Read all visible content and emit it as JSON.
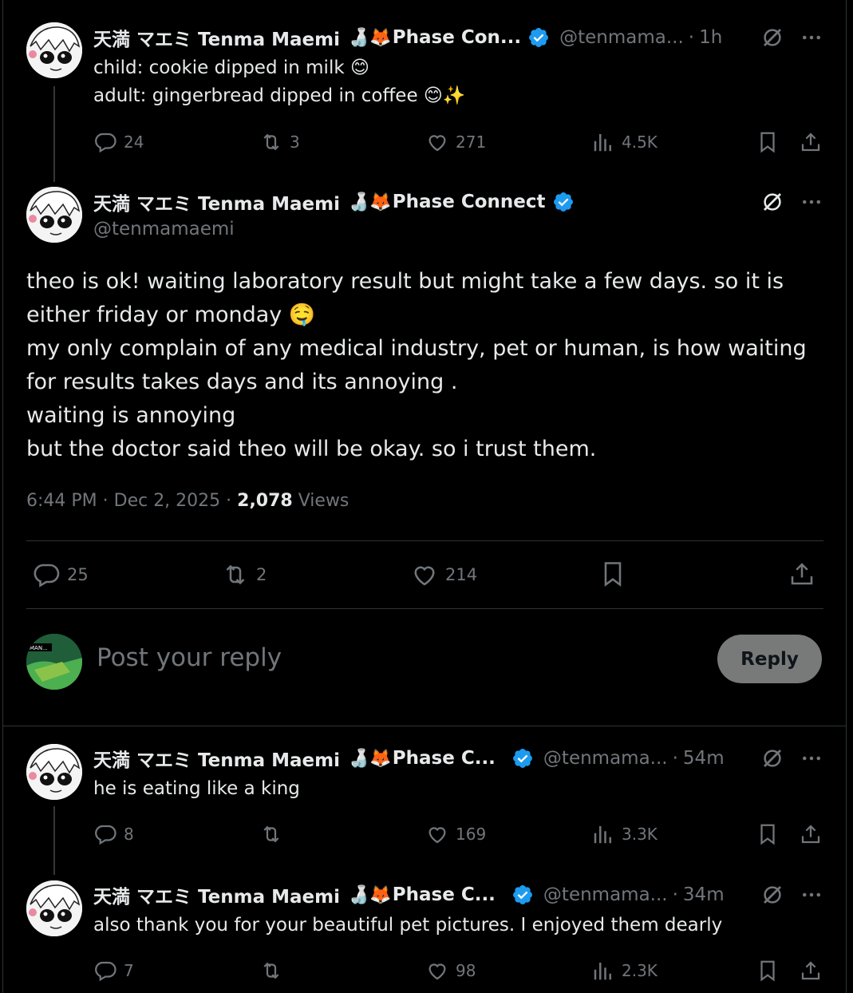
{
  "colors": {
    "background": "#000000",
    "text": "#e7e9ea",
    "muted": "#71767b",
    "verified": "#1d9bf0",
    "divider": "#2f3336",
    "reply_button": "#787a7a"
  },
  "author": {
    "display_name": "天満 マエミ Tenma Maemi",
    "emoji": "🍶🦊",
    "affiliation_short_1": "Phase Con...",
    "affiliation_short_2": "Phase C...",
    "affiliation_full": "Phase Connect",
    "handle_short": "@tenmama...",
    "handle_full": "@tenmamaemi"
  },
  "tweet1": {
    "time": "1h",
    "line1": "child: cookie dipped in milk 😊",
    "line2": "adult: gingerbread dipped in coffee 😊✨",
    "replies": "24",
    "reposts": "3",
    "likes": "271",
    "views": "4.5K"
  },
  "main_tweet": {
    "lines": [
      "theo is ok! waiting laboratory result but might take a few days. so it is",
      "either friday or monday  🤤",
      "my only complain of any medical industry, pet or human, is how waiting",
      "for results takes days and its annoying .",
      "waiting is annoying",
      "but the doctor said theo will be okay. so i trust them."
    ],
    "timestamp": "6:44 PM · Dec 2, 2025 · ",
    "views_count": "2,078",
    "views_label": " Views",
    "replies": "25",
    "reposts": "2",
    "likes": "214"
  },
  "reply_box": {
    "placeholder": "Post your reply",
    "button": "Reply",
    "avatar_text": "MAN..."
  },
  "tweet2": {
    "time": "54m",
    "text": "he is eating like a king",
    "replies": "8",
    "reposts": "",
    "likes": "169",
    "views": "3.3K"
  },
  "tweet3": {
    "time": "34m",
    "text": "also thank you for your beautiful pet pictures. I enjoyed them dearly",
    "replies": "7",
    "reposts": "",
    "likes": "98",
    "views": "2.3K"
  },
  "icons": [
    "reply-icon",
    "repost-icon",
    "like-icon",
    "views-icon",
    "bookmark-icon",
    "share-icon",
    "grok-icon",
    "more-icon",
    "verified-icon"
  ]
}
